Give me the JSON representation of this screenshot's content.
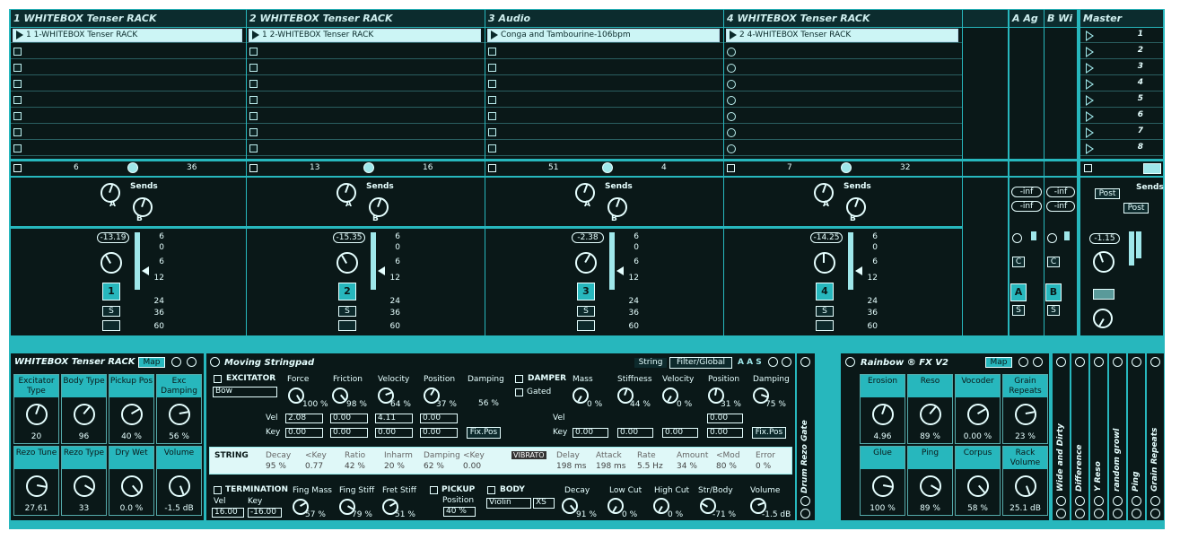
{
  "tracks": [
    {
      "name": "1 WHITEBOX Tenser RACK",
      "clip": "1 1-WHITEBOX Tenser RACK",
      "io_left": "6",
      "io_right": "36",
      "send_label": "Sends",
      "send_a": "A",
      "send_b": "B",
      "volume": "-13.19",
      "number": "1",
      "solo": "S",
      "stop_shape": "square"
    },
    {
      "name": "2 WHITEBOX Tenser RACK",
      "clip": "1 2-WHITEBOX Tenser RACK",
      "io_left": "13",
      "io_right": "16",
      "send_label": "Sends",
      "send_a": "A",
      "send_b": "B",
      "volume": "-15.35",
      "number": "2",
      "solo": "S",
      "stop_shape": "square"
    },
    {
      "name": "3 Audio",
      "clip": "Conga and Tambourine-106bpm",
      "io_left": "51",
      "io_right": "4",
      "send_label": "Sends",
      "send_a": "A",
      "send_b": "B",
      "volume": "-2.38",
      "number": "3",
      "solo": "S",
      "stop_shape": "square"
    },
    {
      "name": "4 WHITEBOX Tenser RACK",
      "clip": "2 4-WHITEBOX Tenser RACK",
      "io_left": "7",
      "io_right": "32",
      "send_label": "Sends",
      "send_a": "A",
      "send_b": "B",
      "volume": "-14.25",
      "number": "4",
      "solo": "S",
      "stop_shape": "circle"
    }
  ],
  "meter_scale": [
    "6",
    "0",
    "6",
    "12",
    "24",
    "36",
    "60"
  ],
  "returns": [
    {
      "name": "A Ag",
      "inf1": "-inf",
      "inf2": "-inf",
      "c": "C",
      "letter": "A",
      "solo": "S"
    },
    {
      "name": "B Wi",
      "inf1": "-inf",
      "inf2": "-inf",
      "c": "C",
      "letter": "B",
      "solo": "S"
    }
  ],
  "master": {
    "name": "Master",
    "scenes": [
      "1",
      "2",
      "3",
      "4",
      "5",
      "6",
      "7",
      "8"
    ],
    "send_label": "Sends",
    "post1": "Post",
    "post2": "Post",
    "volume": "-1.15"
  },
  "rack": {
    "title": "WHITEBOX Tenser RACK",
    "map": "Map",
    "macros": [
      {
        "name": "Excitator Type",
        "value": "20"
      },
      {
        "name": "Body Type",
        "value": "96"
      },
      {
        "name": "Pickup Pos",
        "value": "40 %"
      },
      {
        "name": "Exc Damping",
        "value": "56 %"
      },
      {
        "name": "Rezo Tune",
        "value": "27.61"
      },
      {
        "name": "Rezo Type",
        "value": "33"
      },
      {
        "name": "Dry Wet",
        "value": "0.0 %"
      },
      {
        "name": "Volume",
        "value": "-1.5 dB"
      }
    ]
  },
  "stringpad": {
    "title": "Moving Stringpad",
    "tab_string": "String",
    "tab_filter": "Filter/Global",
    "excitator": {
      "label": "EXCITATOR",
      "type": "Bow",
      "force_l": "Force",
      "force": "100 %",
      "friction_l": "Friction",
      "friction": "98 %",
      "velocity_l": "Velocity",
      "velocity": "64 %",
      "position_l": "Position",
      "position": "37 %",
      "vel_l": "Vel",
      "key_l": "Key",
      "vel_vals": [
        "2.08",
        "0.00",
        "4.11",
        "0.00"
      ],
      "key_vals": [
        "0.00",
        "0.00",
        "0.00",
        "0.00"
      ]
    },
    "damping": {
      "label": "Damping",
      "value": "56 %",
      "fixpos": "Fix.Pos"
    },
    "damper": {
      "label": "DAMPER",
      "gated": "Gated",
      "mass_l": "Mass",
      "mass": "0 %",
      "stiff_l": "Stiffness",
      "stiff": "44 %",
      "vel_l": "Velocity",
      "vel": "0 %",
      "pos_l": "Position",
      "pos": "31 %",
      "damp_l": "Damping",
      "damp": "75 %",
      "row_vel": "Vel",
      "row_key": "Key",
      "vel_field": "0.00",
      "key_vals": [
        "0.00",
        "0.00",
        "0.00",
        "0.00"
      ],
      "fixpos": "Fix.Pos"
    },
    "string_strip": {
      "label": "STRING",
      "headers": [
        "Decay",
        "<Key",
        "Ratio",
        "Inharm",
        "Damping",
        "<Key"
      ],
      "values": [
        "95 %",
        "0.77",
        "42 %",
        "20 %",
        "62 %",
        "0.00"
      ],
      "vibrato": "VIBRATO",
      "vib_headers": [
        "Delay",
        "Attack",
        "Rate",
        "Amount",
        "<Mod",
        "Error"
      ],
      "vib_values": [
        "198 ms",
        "198 ms",
        "5.5 Hz",
        "34 %",
        "80 %",
        "0 %"
      ]
    },
    "termination": {
      "label": "TERMINATION",
      "vel_l": "Vel",
      "key_l": "Key",
      "vel": "16.00",
      "key": "-16.00",
      "fm_l": "Fing Mass",
      "fm": "57 %",
      "fs_l": "Fing Stiff",
      "fs": "79 %",
      "fr_l": "Fret Stiff",
      "fr": "51 %"
    },
    "pickup": {
      "label": "PICKUP",
      "pos_l": "Position",
      "pos": "40 %"
    },
    "body": {
      "label": "BODY",
      "type": "Violin",
      "size": "XS",
      "decay_l": "Decay",
      "decay": "91 %",
      "lc_l": "Low Cut",
      "lc": "0 %",
      "hc_l": "High Cut",
      "hc": "0 %",
      "sb_l": "Str/Body",
      "sb": "-71 %"
    },
    "volume": {
      "label": "Volume",
      "value": "-1.5 dB"
    }
  },
  "drum_gate": "Drum Rezo Gate",
  "rainbow": {
    "title": "Rainbow ® FX V2",
    "map": "Map",
    "macros": [
      {
        "name": "Erosion",
        "value": "4.96"
      },
      {
        "name": "Reso",
        "value": "89 %"
      },
      {
        "name": "Vocoder",
        "value": "0.00 %"
      },
      {
        "name": "Grain Repeats",
        "value": "23 %"
      },
      {
        "name": "Glue",
        "value": "100 %"
      },
      {
        "name": "Ping",
        "value": "89 %"
      },
      {
        "name": "Corpus",
        "value": "58 %"
      },
      {
        "name": "Rack Volume",
        "value": "25.1 dB"
      }
    ]
  },
  "fx_strips": [
    "Wide and Dirty",
    "Difference",
    "Y Reso",
    "random growl",
    "Ping",
    "Grain Repeats"
  ]
}
